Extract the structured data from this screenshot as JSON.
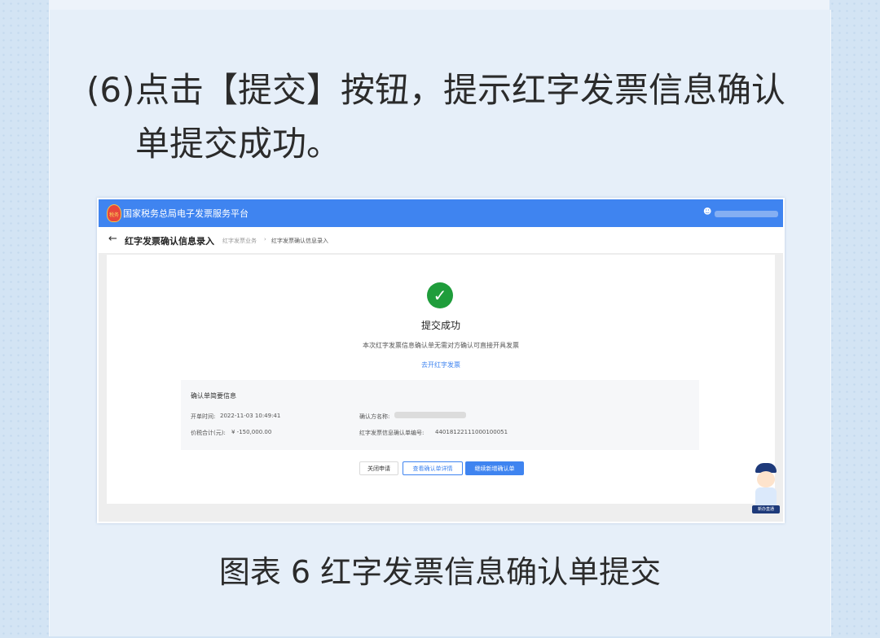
{
  "instruction": {
    "number": "(6)",
    "line1": "点击【提交】按钮，提示红字发票信息确认",
    "line2": "单提交成功。"
  },
  "app": {
    "title": "国家税务总局电子发票服务平台",
    "emblem_text": "税务",
    "user_icon": "user-icon"
  },
  "nav": {
    "back_icon": "back-arrow-icon",
    "page_title": "红字发票确认信息录入",
    "breadcrumb": [
      "红字发票业务",
      "红字发票确认信息录入"
    ],
    "separator": "›"
  },
  "result": {
    "icon": "check-circle-icon",
    "title": "提交成功",
    "description": "本次红字发票信息确认单无需对方确认可直接开具发票",
    "link": "去开红字发票"
  },
  "summary": {
    "title": "确认单简要信息",
    "issue_time_label": "开单时间:",
    "issue_time_value": "2022-11-03 10:49:41",
    "total_label": "价税合计(元):",
    "total_value": "¥ -150,000.00",
    "confirmer_label": "确认方名称:",
    "confirm_no_label": "红字发票信息确认单编号:",
    "confirm_no_value": "44018122111000100051"
  },
  "buttons": {
    "close": "关闭申请",
    "view": "查看确认单详情",
    "add": "继续新增确认单"
  },
  "mascot": {
    "badge": "新办直通"
  },
  "caption": "图表 6 红字发票信息确认单提交",
  "colors": {
    "primary": "#3f84f0",
    "success": "#1f9d3b"
  }
}
